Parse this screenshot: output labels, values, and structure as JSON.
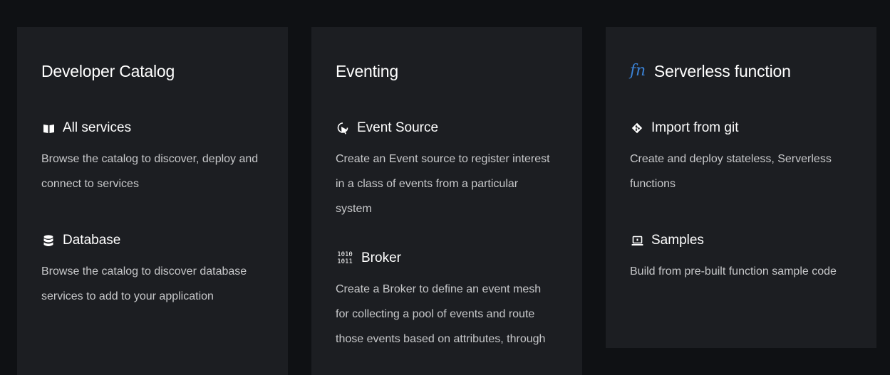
{
  "cards": [
    {
      "title": "Developer Catalog",
      "items": [
        {
          "icon": "book-icon",
          "label": "All services",
          "description": "Browse the catalog to discover, deploy and connect to services"
        },
        {
          "icon": "database-icon",
          "label": "Database",
          "description": "Browse the catalog to discover database services to add to your application"
        }
      ]
    },
    {
      "title": "Eventing",
      "items": [
        {
          "icon": "event-source-icon",
          "label": "Event Source",
          "description": "Create an Event source to register interest in a class of events from a particular system"
        },
        {
          "icon": "binary-broker-icon",
          "icon_text": [
            "1010",
            "1011"
          ],
          "label": "Broker",
          "description": "Create a Broker to define an event mesh for collecting a pool of events and route those events based on attributes, through"
        }
      ]
    },
    {
      "title": "Serverless function",
      "title_icon": "fn",
      "items": [
        {
          "icon": "git-icon",
          "label": "Import from git",
          "description": "Create and deploy stateless, Serverless functions"
        },
        {
          "icon": "laptop-icon",
          "label": "Samples",
          "description": "Build from pre-built function sample code"
        }
      ]
    }
  ]
}
